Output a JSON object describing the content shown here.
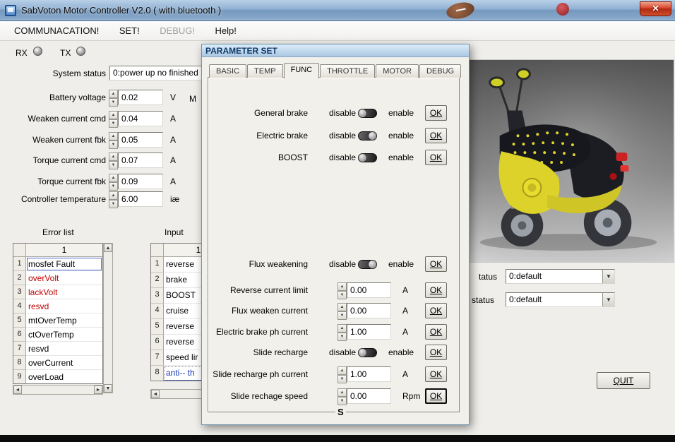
{
  "window": {
    "title": "SabVoton Motor Controller V2.0 ( with bluetooth )",
    "close_glyph": "✕"
  },
  "menu": {
    "items": [
      {
        "label": "COMMUNACATION!",
        "enabled": true
      },
      {
        "label": "SET!",
        "enabled": true
      },
      {
        "label": "DEBUG!",
        "enabled": false
      },
      {
        "label": "Help!",
        "enabled": true
      }
    ]
  },
  "status_leds": {
    "rx_label": "RX",
    "tx_label": "TX"
  },
  "left_panel": {
    "system_status_label": "System status",
    "system_status_value": "0:power up no finished",
    "hidden_fragment": "M",
    "fields": [
      {
        "label": "Battery voltage",
        "value": "0.02",
        "unit": "V"
      },
      {
        "label": "Weaken current cmd",
        "value": "0.04",
        "unit": "A"
      },
      {
        "label": "Weaken current fbk",
        "value": "0.05",
        "unit": "A"
      },
      {
        "label": "Torque current cmd",
        "value": "0.07",
        "unit": "A"
      },
      {
        "label": "Torque current fbk",
        "value": "0.09",
        "unit": "A"
      },
      {
        "label": "Controller temperature",
        "value": "6.00",
        "unit": "iæ"
      }
    ],
    "error_list": {
      "title": "Error list",
      "col_header": "1",
      "rows": [
        {
          "num": "1",
          "text": "mosfet Fault",
          "style": "selected"
        },
        {
          "num": "2",
          "text": "overVolt",
          "style": "red"
        },
        {
          "num": "3",
          "text": "lackVolt",
          "style": "red"
        },
        {
          "num": "4",
          "text": "resvd",
          "style": "red"
        },
        {
          "num": "5",
          "text": "mtOverTemp",
          "style": "normal"
        },
        {
          "num": "6",
          "text": "ctOverTemp",
          "style": "normal"
        },
        {
          "num": "7",
          "text": "resvd",
          "style": "normal"
        },
        {
          "num": "8",
          "text": "overCurrent",
          "style": "normal"
        },
        {
          "num": "9",
          "text": "overLoad",
          "style": "normal"
        }
      ]
    },
    "input_list": {
      "title": "Input",
      "col_header": "1",
      "rows": [
        {
          "num": "1",
          "text": "reverse",
          "style": "normal"
        },
        {
          "num": "2",
          "text": "brake",
          "style": "normal"
        },
        {
          "num": "3",
          "text": "BOOST",
          "style": "normal"
        },
        {
          "num": "4",
          "text": "cruise",
          "style": "normal"
        },
        {
          "num": "5",
          "text": "reverse",
          "style": "normal"
        },
        {
          "num": "6",
          "text": "reverse",
          "style": "normal"
        },
        {
          "num": "7",
          "text": "speed lir",
          "style": "normal"
        },
        {
          "num": "8",
          "text": "anti-- th",
          "style": "selected"
        }
      ]
    }
  },
  "dialog": {
    "title": "PARAMETER SET",
    "tabs": [
      {
        "label": "BASIC",
        "active": false
      },
      {
        "label": "TEMP",
        "active": false
      },
      {
        "label": "FUNC",
        "active": true
      },
      {
        "label": "THROTTLE",
        "active": false
      },
      {
        "label": "MOTOR",
        "active": false
      },
      {
        "label": "DEBUG",
        "active": false
      }
    ],
    "disable_label": "disable",
    "enable_label": "enable",
    "ok_label": "OK",
    "bottom_fragment": "S",
    "rows": [
      {
        "type": "toggle",
        "label": "General brake",
        "knob": "left"
      },
      {
        "type": "toggle",
        "label": "Electric brake",
        "knob": "right"
      },
      {
        "type": "toggle",
        "label": "BOOST",
        "knob": "left"
      },
      {
        "type": "toggle",
        "label": "Flux weakening",
        "knob": "right"
      },
      {
        "type": "spin",
        "label": "Reverse current limit",
        "value": "0.00",
        "unit": "A"
      },
      {
        "type": "spin",
        "label": "Flux weaken current",
        "value": "0.00",
        "unit": "A"
      },
      {
        "type": "spin",
        "label": "Electric brake ph current",
        "value": "1.00",
        "unit": "A"
      },
      {
        "type": "toggle",
        "label": "Slide recharge",
        "knob": "left"
      },
      {
        "type": "spin",
        "label": "Slide recharge ph current",
        "value": "1.00",
        "unit": "A"
      },
      {
        "type": "spin",
        "label": "Slide rechage speed",
        "value": "0.00",
        "unit": "Rpm",
        "default": true
      }
    ]
  },
  "right_panel": {
    "label_fragment_1": "tatus",
    "combo1_value": "0:default",
    "label_fragment_2": "status",
    "combo2_value": "0:default",
    "quit_label": "QUIT"
  },
  "colors": {
    "accent_blue": "#3a6ea5",
    "error_red": "#c00000",
    "selection_blue": "#2a5ad4",
    "scooter_yellow": "#ddd22a"
  }
}
